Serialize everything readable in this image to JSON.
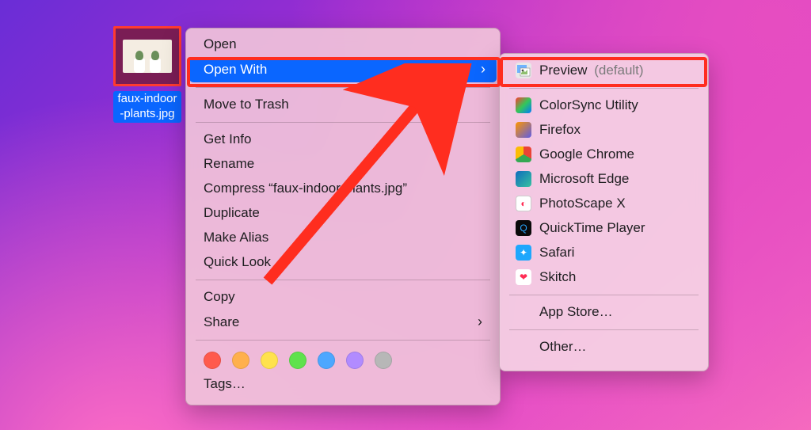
{
  "file": {
    "name": "faux-indoor-plants.jpg"
  },
  "context_menu": {
    "open": "Open",
    "open_with": "Open With",
    "move_to_trash": "Move to Trash",
    "get_info": "Get Info",
    "rename": "Rename",
    "compress": "Compress “faux-indoor-plants.jpg”",
    "duplicate": "Duplicate",
    "make_alias": "Make Alias",
    "quick_look": "Quick Look",
    "copy": "Copy",
    "share": "Share",
    "tags": "Tags…"
  },
  "tag_colors": [
    "#ff5a4d",
    "#ffb04d",
    "#ffe24d",
    "#5fe24d",
    "#4da7ff",
    "#b18bff",
    "#b7b7b7"
  ],
  "open_with": {
    "default_app": {
      "label": "Preview",
      "suffix": "(default)"
    },
    "apps": [
      {
        "label": "ColorSync Utility",
        "icon": "colorsync"
      },
      {
        "label": "Firefox",
        "icon": "firefox"
      },
      {
        "label": "Google Chrome",
        "icon": "chrome"
      },
      {
        "label": "Microsoft Edge",
        "icon": "edge"
      },
      {
        "label": "PhotoScape X",
        "icon": "photoscape"
      },
      {
        "label": "QuickTime Player",
        "icon": "qt"
      },
      {
        "label": "Safari",
        "icon": "safari"
      },
      {
        "label": "Skitch",
        "icon": "skitch"
      }
    ],
    "app_store": "App Store…",
    "other": "Other…"
  }
}
